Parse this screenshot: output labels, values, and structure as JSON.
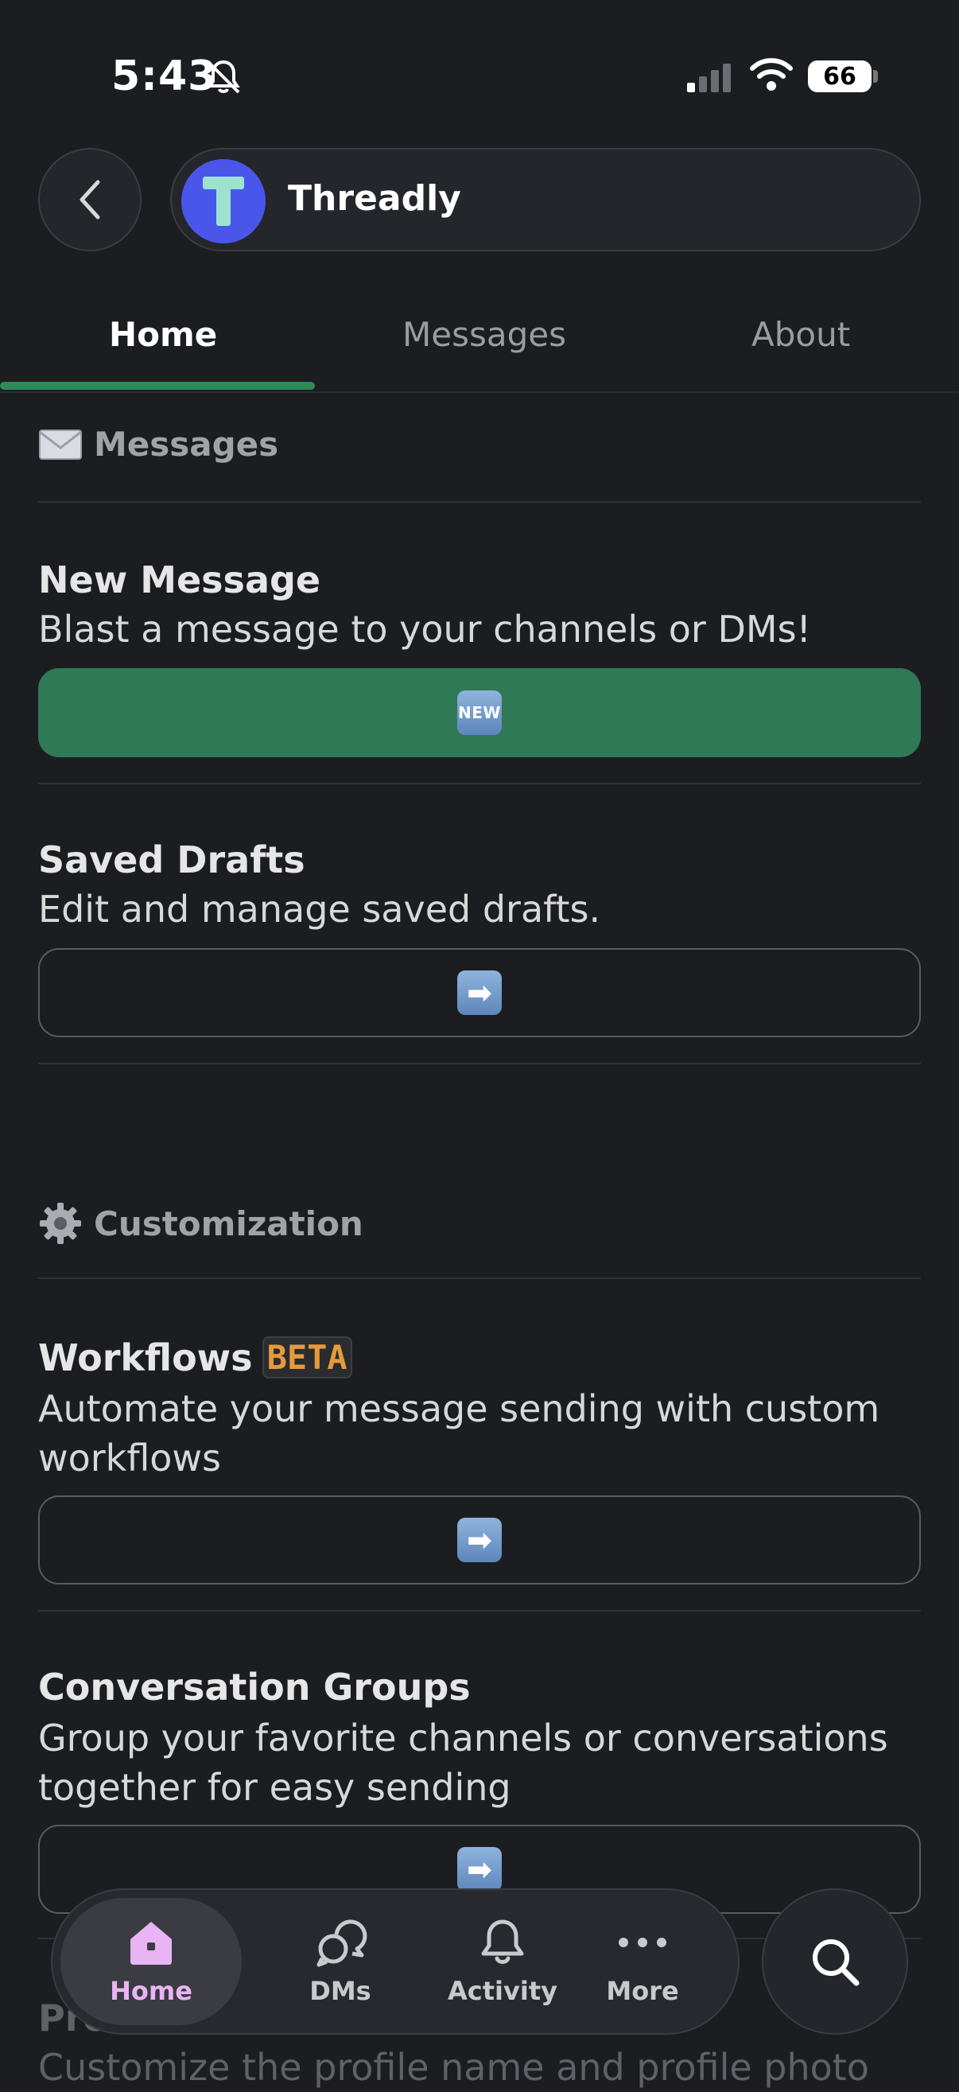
{
  "status": {
    "time": "5:43",
    "battery": "66"
  },
  "header": {
    "app_name": "Threadly",
    "avatar_letter": "T"
  },
  "tabs": [
    {
      "label": "Home",
      "active": true
    },
    {
      "label": "Messages",
      "active": false
    },
    {
      "label": "About",
      "active": false
    }
  ],
  "sections": {
    "messages": {
      "icon": "envelope-icon",
      "title": "Messages",
      "items": {
        "new_message": {
          "title": "New Message",
          "description": "Blast a message to your channels or DMs!",
          "button_icon": "NEW"
        },
        "saved_drafts": {
          "title": "Saved Drafts",
          "description": "Edit and manage saved drafts.",
          "button_icon": "➡"
        }
      }
    },
    "customization": {
      "icon": "gear-icon",
      "title": "Customization",
      "items": {
        "workflows": {
          "title": "Workflows",
          "badge": "BETA",
          "description": "Automate your message sending with custom workflows",
          "button_icon": "➡"
        },
        "conversation_groups": {
          "title": "Conversation Groups",
          "description": "Group your favorite channels or conversations together for easy sending",
          "button_icon": "➡"
        },
        "profile": {
          "title": "Pro",
          "description": "Customize the profile name and profile photo"
        }
      }
    }
  },
  "bottom_nav": {
    "items": [
      {
        "label": "Home",
        "active": true
      },
      {
        "label": "DMs",
        "active": false
      },
      {
        "label": "Activity",
        "active": false
      },
      {
        "label": "More",
        "active": false
      }
    ]
  },
  "colors": {
    "accent_green": "#2f7956",
    "active_nav": "#e9b4f4",
    "avatar_bg": "#4a56ea",
    "beta": "#e49a3d"
  }
}
